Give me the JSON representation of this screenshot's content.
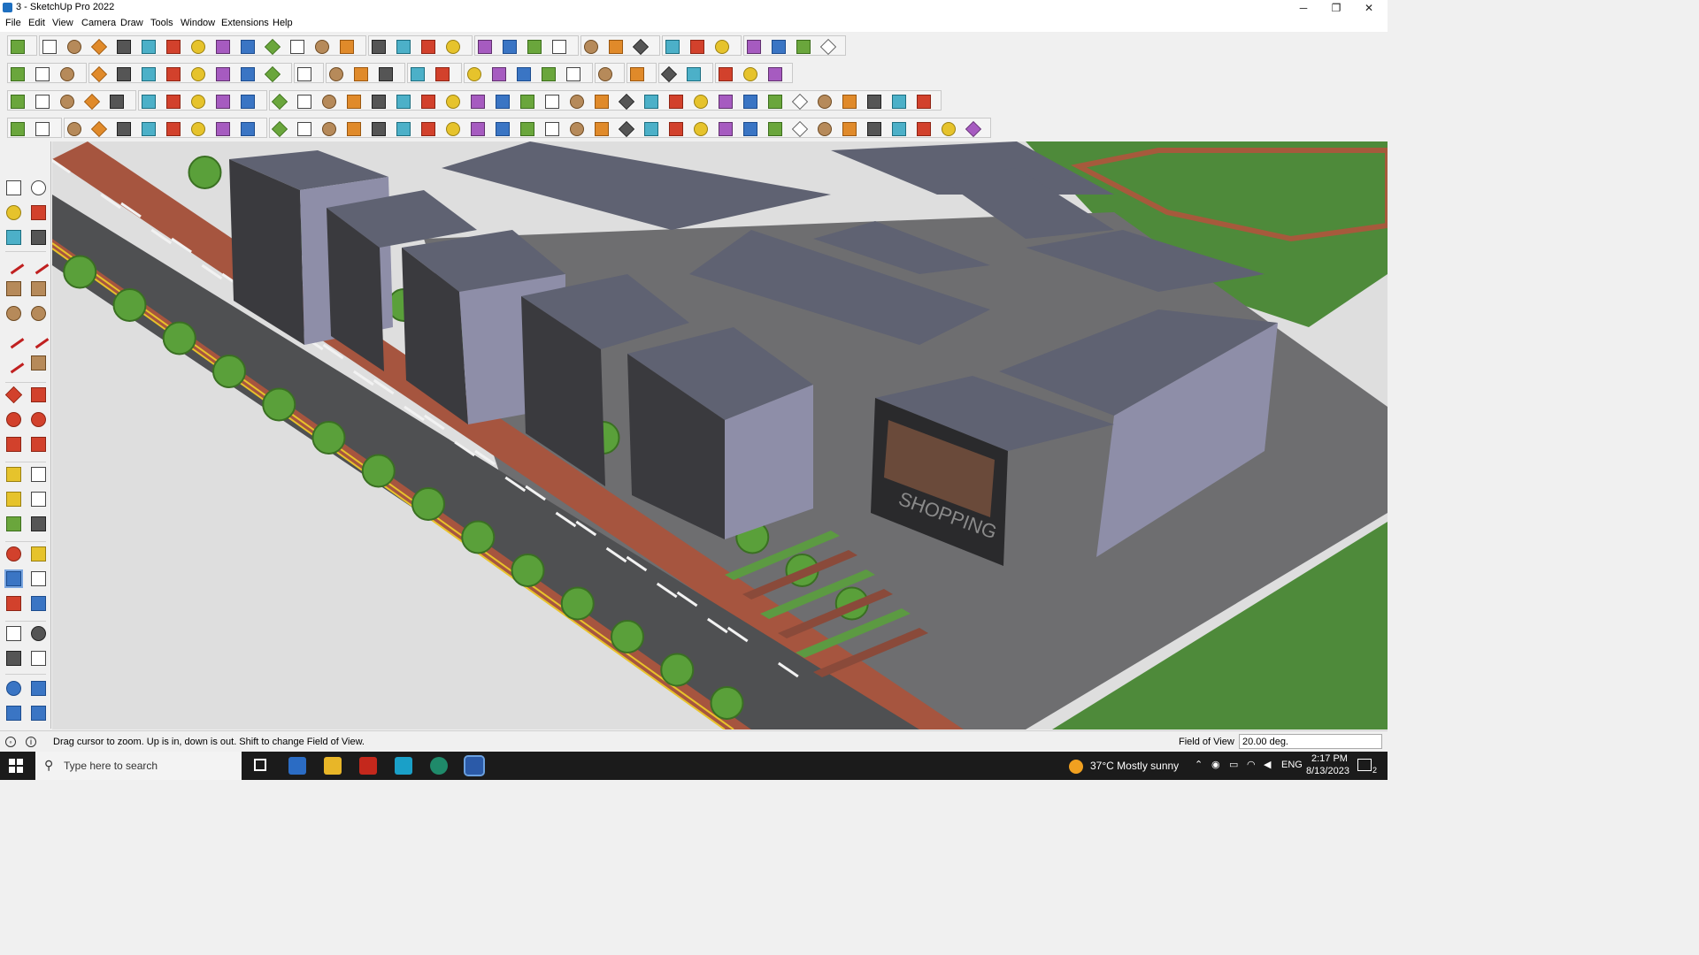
{
  "window": {
    "title": "3 - SketchUp Pro 2022",
    "controls": {
      "minimize": "─",
      "maximize": "❐",
      "close": "✕"
    }
  },
  "menu": [
    "File",
    "Edit",
    "View",
    "Camera",
    "Draw",
    "Tools",
    "Window",
    "Extensions",
    "Help"
  ],
  "toolbars": {
    "row1_icons": [
      "zoom-icon",
      "select-icon",
      "eraser-icon",
      "line-icon",
      "arc-icon",
      "rectangle-icon",
      "push-pull-icon",
      "follow-me-icon",
      "move-icon",
      "rotate-icon",
      "scale-icon",
      "tape-measure-icon",
      "text-icon",
      "paint-bucket-icon",
      "orbit-icon",
      "pan-icon",
      "zoom-window-icon",
      "zoom-extents-icon",
      "styles-icon",
      "layers-icon",
      "components-icon",
      "materials-icon",
      "user-icon",
      "warehouse-icon",
      "extension-warehouse-icon",
      "send-to-layout-icon",
      "flip-icon",
      "sandbox-icon",
      "section-plane-icon",
      "undo-icon",
      "redo-icon",
      "print-icon"
    ],
    "row2_icons": [
      "box-icon",
      "cube-wire-icon",
      "cube-xray-icon",
      "push-icon",
      "axis-move-icon",
      "axis-move-icon",
      "axis-move-icon",
      "axis-move-icon",
      "axis-move-icon",
      "axis-move-icon",
      "axis-move-icon",
      "tube-icon",
      "plane-icon",
      "plane-icon",
      "plane-icon",
      "terrain-icon",
      "terrain-icon",
      "house-icon",
      "house-icon",
      "house-icon",
      "house-icon",
      "house-icon",
      "font-icon",
      "hand-icon",
      "pencil-icon",
      "shapes-icon",
      "eraser-icon",
      "brick-icon",
      "stone-icon"
    ],
    "row3_icons": [
      "face-icon",
      "face-icon",
      "face-icon",
      "face-icon",
      "face-icon",
      "plane-icon",
      "arc-icon",
      "square-icon",
      "list-icon",
      "door-icon",
      "box-icon",
      "link-icon",
      "line-icon",
      "nodes-icon",
      "cross-icon",
      "cross-icon",
      "fork-icon",
      "cone-icon",
      "pyramid-icon",
      "loop-icon",
      "loop-icon",
      "circle-arrow-icon",
      "star-icon",
      "cube-icon",
      "back-icon",
      "component-icon",
      "component-icon",
      "component-icon",
      "cube-icon",
      "gear-icon",
      "window-icon",
      "grid-icon",
      "grid-icon",
      "grid-icon",
      "x-icon",
      "curve-icon",
      "grid-icon"
    ],
    "row4_icons": [
      "path-icon",
      "path-icon",
      "car-icon",
      "bezier-icon",
      "sphere-icon",
      "tube-icon",
      "pipe-icon",
      "face-icon",
      "twist-icon",
      "bend-icon",
      "line-icon",
      "line-icon",
      "line-icon",
      "curve-icon",
      "house-icon",
      "tent-icon",
      "fence-icon",
      "fence-icon",
      "mesh-icon",
      "mesh-icon",
      "curtain-icon",
      "stair-icon",
      "stair-icon",
      "ramp-icon",
      "ramp-icon",
      "rail-icon",
      "rail-icon",
      "box-icon",
      "slant-icon",
      "wall-icon",
      "column-icon",
      "grille-icon",
      "grille-icon",
      "grille-icon",
      "gear-icon",
      "gear-icon",
      "wave-icon",
      "wave-icon",
      "polygon-icon"
    ]
  },
  "viewport": {
    "sign_text": "SHOPPING",
    "colors": {
      "road": "#4f5052",
      "lane": "#e8c22a",
      "sidewalk": "#a6553f",
      "grass": "#4e8a3a",
      "roof": "#5f6272",
      "wall": "#8e8ea8",
      "plaza": "#6e6e70"
    }
  },
  "status": {
    "message": "Drag cursor to zoom.  Up is in, down is out. Shift to change Field of View.",
    "vcb_label": "Field of View",
    "vcb_value": "20.00 deg."
  },
  "taskbar": {
    "search_placeholder": "Type here to search",
    "weather": "37°C  Mostly sunny",
    "language": "ENG",
    "time": "2:17 PM",
    "date": "8/13/2023",
    "notifications": "2"
  }
}
